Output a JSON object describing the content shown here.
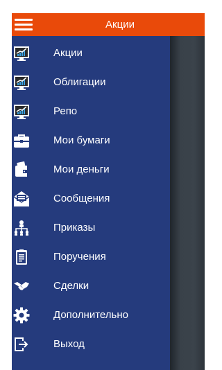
{
  "header": {
    "title": "Акции",
    "menu_icon": "hamburger-icon",
    "color": "#e94a0a"
  },
  "drawer": {
    "color": "#253b7d",
    "items": [
      {
        "label": "Акции",
        "icon": "chart-monitor-icon"
      },
      {
        "label": "Облигации",
        "icon": "chart-monitor-icon"
      },
      {
        "label": "Репо",
        "icon": "chart-monitor-icon"
      },
      {
        "label": "Мои бумаги",
        "icon": "briefcase-icon"
      },
      {
        "label": "Мои деньги",
        "icon": "wallet-icon"
      },
      {
        "label": "Сообщения",
        "icon": "envelope-icon"
      },
      {
        "label": "Приказы",
        "icon": "hierarchy-icon"
      },
      {
        "label": "Поручения",
        "icon": "clipboard-icon"
      },
      {
        "label": "Сделки",
        "icon": "handshake-icon"
      },
      {
        "label": "Дополнительно",
        "icon": "gear-icon"
      },
      {
        "label": "Выход",
        "icon": "logout-icon"
      }
    ]
  }
}
